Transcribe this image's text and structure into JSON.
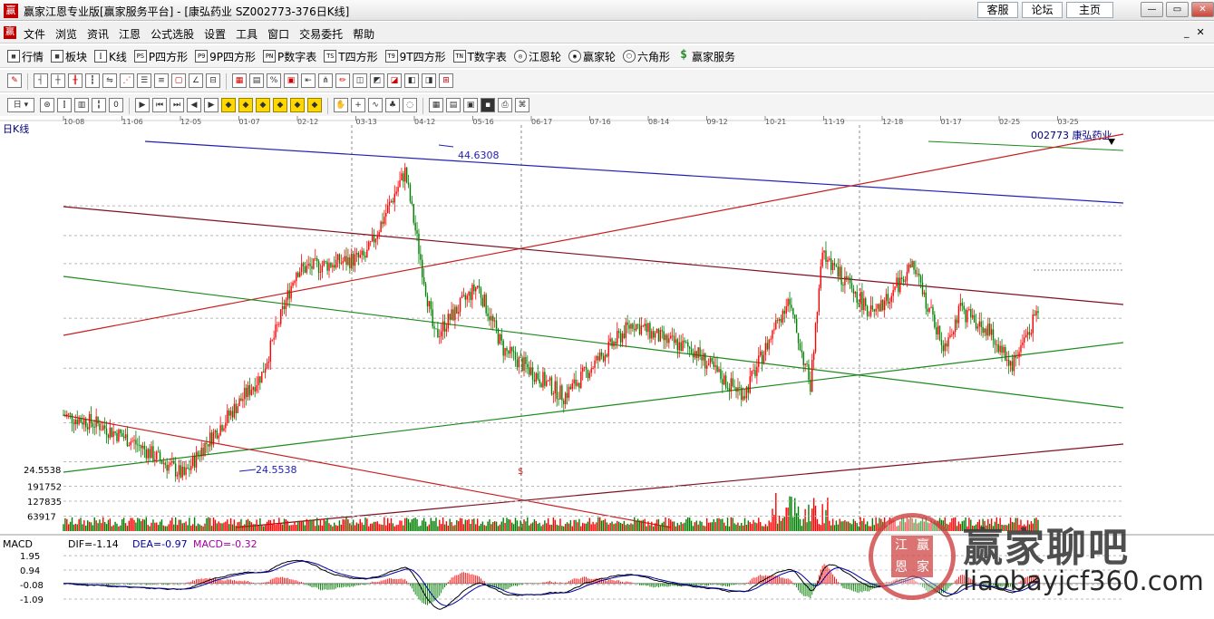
{
  "window": {
    "app_icon": "赢",
    "title": "赢家江恩专业版[赢家服务平台] - [康弘药业  SZ002773-376日K线]",
    "links": [
      "客服",
      "论坛",
      "主页"
    ],
    "controls": [
      "—",
      "▭",
      "✕"
    ]
  },
  "menu": {
    "icon": "赢",
    "items": [
      "文件",
      "浏览",
      "资讯",
      "江恩",
      "公式选股",
      "设置",
      "工具",
      "窗口",
      "交易委托",
      "帮助"
    ],
    "mdi": [
      "_",
      "✕"
    ]
  },
  "toolbar1": [
    {
      "icon": "grid-icon",
      "glyph": "▦",
      "label": "行情"
    },
    {
      "icon": "blocks-icon",
      "glyph": "▩",
      "label": "板块"
    },
    {
      "icon": "kline-icon",
      "glyph": "⫿",
      "label": "K线"
    },
    {
      "icon": "ps-icon",
      "glyph": "PS",
      "label": "P四方形"
    },
    {
      "icon": "p9-icon",
      "glyph": "P9",
      "label": "9P四方形"
    },
    {
      "icon": "pn-icon",
      "glyph": "PN",
      "label": "P数字表"
    },
    {
      "icon": "ts-icon",
      "glyph": "TS",
      "label": "T四方形"
    },
    {
      "icon": "t9-icon",
      "glyph": "T9",
      "label": "9T四方形"
    },
    {
      "icon": "tn-icon",
      "glyph": "TN",
      "label": "T数字表"
    },
    {
      "icon": "gann-wheel-icon",
      "glyph": "◎",
      "label": "江恩轮"
    },
    {
      "icon": "winner-wheel-icon",
      "glyph": "◉",
      "label": "赢家轮"
    },
    {
      "icon": "hexagon-icon",
      "glyph": "⬡",
      "label": "六角形"
    },
    {
      "icon": "dollar-icon",
      "glyph": "$",
      "label": "赢家服务"
    }
  ],
  "toolbar2": {
    "percent_label": "%",
    "icons": [
      "pen-icon",
      "bars-icon",
      "multi-bars-icon",
      "candle-icon",
      "candle-multi-icon",
      "dual-icon",
      "fan-icon",
      "ladder-icon",
      "lines-icon",
      "square-icon",
      "angle-icon",
      "lines2-icon",
      "table-icon",
      "grid2-icon",
      "percent-icon",
      "box-icon",
      "arrow-left-icon",
      "comb-icon",
      "pencil-icon",
      "chart-a-icon",
      "chart-b-icon",
      "chart-c-icon",
      "chart-d-icon",
      "chart-e-icon",
      "chart-f-icon"
    ]
  },
  "toolbar3": {
    "period_label": "日",
    "icons": [
      "target-icon",
      "kline-small-icon",
      "volume-icon",
      "candle-small-icon",
      "zero-icon",
      "play-icon",
      "first-icon",
      "last-icon",
      "prev-icon",
      "next-icon",
      "diamond1-icon",
      "diamond2-icon",
      "diamond3-icon",
      "diamond4-icon",
      "diamond5-icon",
      "diamond6-icon",
      "hand-icon",
      "cross-icon",
      "wave-icon",
      "tree-icon",
      "bubble-icon",
      "calendar-icon",
      "calc-icon",
      "table2-icon",
      "save-icon",
      "printer-icon",
      "network-icon"
    ]
  },
  "chart_data": {
    "type": "candlestick",
    "title": "日K线",
    "stock_label": "002773  康弘药业",
    "x_ticks": [
      "10-08",
      "11-06",
      "12-05",
      "01-07",
      "02-12",
      "03-13",
      "04-12",
      "05-16",
      "06-17",
      "07-16",
      "08-14",
      "09-12",
      "10-21",
      "11-19",
      "12-18",
      "01-17",
      "02-25",
      "03-25"
    ],
    "price": {
      "high_label": "44.6308",
      "low_label": "24.5538",
      "axis_label": "24.5538",
      "ylim": [
        22.6,
        47.0
      ]
    },
    "volume_axis": [
      "191752",
      "127835",
      "63917"
    ],
    "volume_max": 255670,
    "macd": {
      "label": "MACD",
      "dif": "DIF=-1.14",
      "dea": "DEA=-0.97",
      "macd": "MACD=-0.32",
      "axis": [
        "1.95",
        "0.94",
        "-0.08",
        "-1.09"
      ],
      "ylim": [
        -2.3,
        2.4
      ]
    },
    "colors": {
      "up": "#ff0000",
      "down": "#008000",
      "dif": "#000000",
      "dea": "#0000a0",
      "grid": "#b8b8b8",
      "blue_line": "#1f1fb5",
      "red_line": "#c81e1e",
      "maroon_line": "#801020",
      "green_line": "#1c8a1c"
    },
    "marker_label": "$"
  },
  "watermark": {
    "seal_chars": [
      "江",
      "赢",
      "恩",
      "家"
    ],
    "title": "赢家聊吧",
    "url": "liaobayjcf360.com"
  }
}
